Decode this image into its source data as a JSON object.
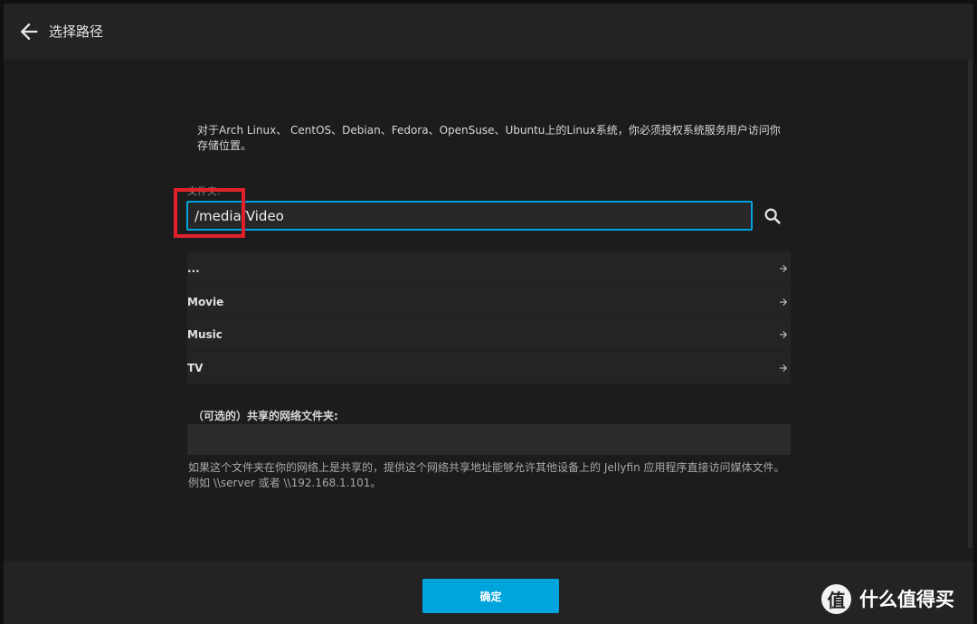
{
  "header": {
    "title": "选择路径"
  },
  "instruction": "对于Arch Linux、 CentOS、Debian、Fedora、OpenSuse、Ubuntu上的Linux系统，你必须授权系统服务用户访问你存储位置。",
  "folder": {
    "label": "文件夹:",
    "value": "/media/Video"
  },
  "directories": [
    {
      "label": "..."
    },
    {
      "label": "Movie"
    },
    {
      "label": "Music"
    },
    {
      "label": "TV"
    }
  ],
  "share": {
    "label": "（可选的）共享的网络文件夹:",
    "value": "",
    "help": "如果这个文件夹在你的网络上是共享的，提供这个网络共享地址能够允许其他设备上的 Jellyfin 应用程序直接访问媒体文件。例如 \\\\server 或者 \\\\192.168.1.101。"
  },
  "footer": {
    "ok_label": "确定"
  },
  "watermark": {
    "logo_char": "值",
    "text": "什么值得买"
  },
  "colors": {
    "accent": "#00a4dc",
    "highlight": "#e0212c",
    "background": "#1c1c1c"
  }
}
